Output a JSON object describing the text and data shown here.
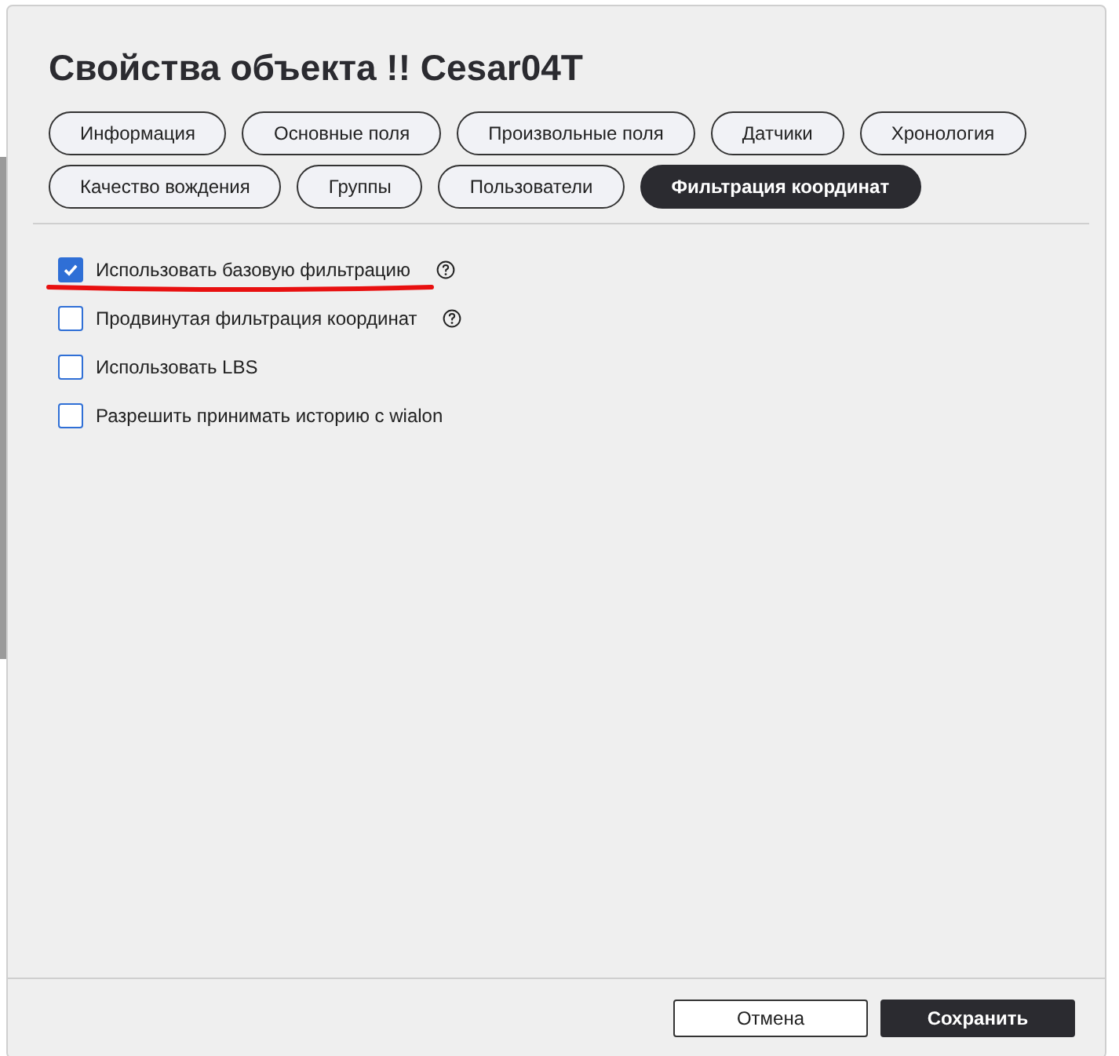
{
  "dialog": {
    "title": "Свойства объекта !! Cesar04T"
  },
  "tabs": [
    {
      "label": "Информация",
      "selected": false
    },
    {
      "label": "Основные поля",
      "selected": false
    },
    {
      "label": "Произвольные поля",
      "selected": false
    },
    {
      "label": "Датчики",
      "selected": false
    },
    {
      "label": "Хронология",
      "selected": false
    },
    {
      "label": "Качество вождения",
      "selected": false
    },
    {
      "label": "Группы",
      "selected": false
    },
    {
      "label": "Пользователи",
      "selected": false
    },
    {
      "label": "Фильтрация координат",
      "selected": true
    }
  ],
  "options": [
    {
      "label": "Использовать базовую фильтрацию",
      "checked": true,
      "help": true,
      "underlined": true
    },
    {
      "label": "Продвинутая фильтрация координат",
      "checked": false,
      "help": true,
      "underlined": false
    },
    {
      "label": "Использовать LBS",
      "checked": false,
      "help": false,
      "underlined": false
    },
    {
      "label": "Разрешить принимать историю с wialon",
      "checked": false,
      "help": false,
      "underlined": false
    }
  ],
  "buttons": [
    {
      "label": "Отмена",
      "kind": "secondary"
    },
    {
      "label": "Сохранить",
      "kind": "primary"
    }
  ]
}
